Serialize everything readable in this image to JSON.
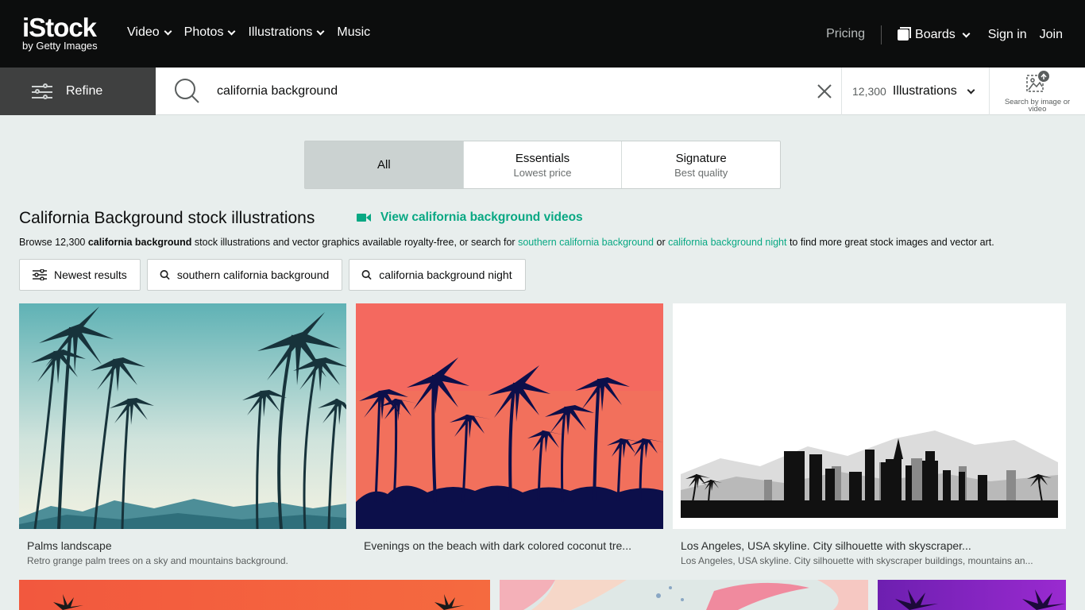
{
  "brand": {
    "logo_main": "iStock",
    "logo_sub": "by Getty Images"
  },
  "nav": {
    "items": [
      {
        "label": "Video",
        "has_menu": true
      },
      {
        "label": "Photos",
        "has_menu": true
      },
      {
        "label": "Illustrations",
        "has_menu": true
      },
      {
        "label": "Music",
        "has_menu": false
      }
    ],
    "pricing": "Pricing",
    "boards": "Boards",
    "signin": "Sign in",
    "join": "Join"
  },
  "search": {
    "refine_label": "Refine",
    "query": "california background",
    "result_count": "12,300",
    "type_label": "Illustrations",
    "image_search_label": "Search by image or video"
  },
  "tabs": [
    {
      "title": "All",
      "sub": "",
      "active": true
    },
    {
      "title": "Essentials",
      "sub": "Lowest price",
      "active": false
    },
    {
      "title": "Signature",
      "sub": "Best quality",
      "active": false
    }
  ],
  "heading": {
    "title": "California Background stock illustrations",
    "video_link": "View california background videos"
  },
  "browse": {
    "prefix": "Browse 12,300 ",
    "bold": "california background",
    "middle": " stock illustrations and vector graphics available royalty-free, or search for ",
    "link1": "southern california background",
    "or": " or ",
    "link2": "california background night",
    "suffix": " to find more great stock images and vector art."
  },
  "chips": [
    {
      "label": "Newest results",
      "icon": "sliders-icon"
    },
    {
      "label": "southern california background",
      "icon": "search-icon"
    },
    {
      "label": "california background night",
      "icon": "search-icon"
    }
  ],
  "results": [
    {
      "title": "Palms landscape",
      "subtitle": "Retro grange palm trees on a sky and mountains background."
    },
    {
      "title": "Evenings on the beach with dark colored coconut tre...",
      "subtitle": ""
    },
    {
      "title": "Los Angeles, USA skyline. City silhouette with skyscraper...",
      "subtitle": "Los Angeles, USA skyline. City silhouette with skyscraper buildings, mountains an..."
    }
  ],
  "colors": {
    "accent": "#08a883",
    "topbar": "#0c0d0d",
    "page_bg": "#e8eeed",
    "refine_bg": "#3f4040"
  }
}
